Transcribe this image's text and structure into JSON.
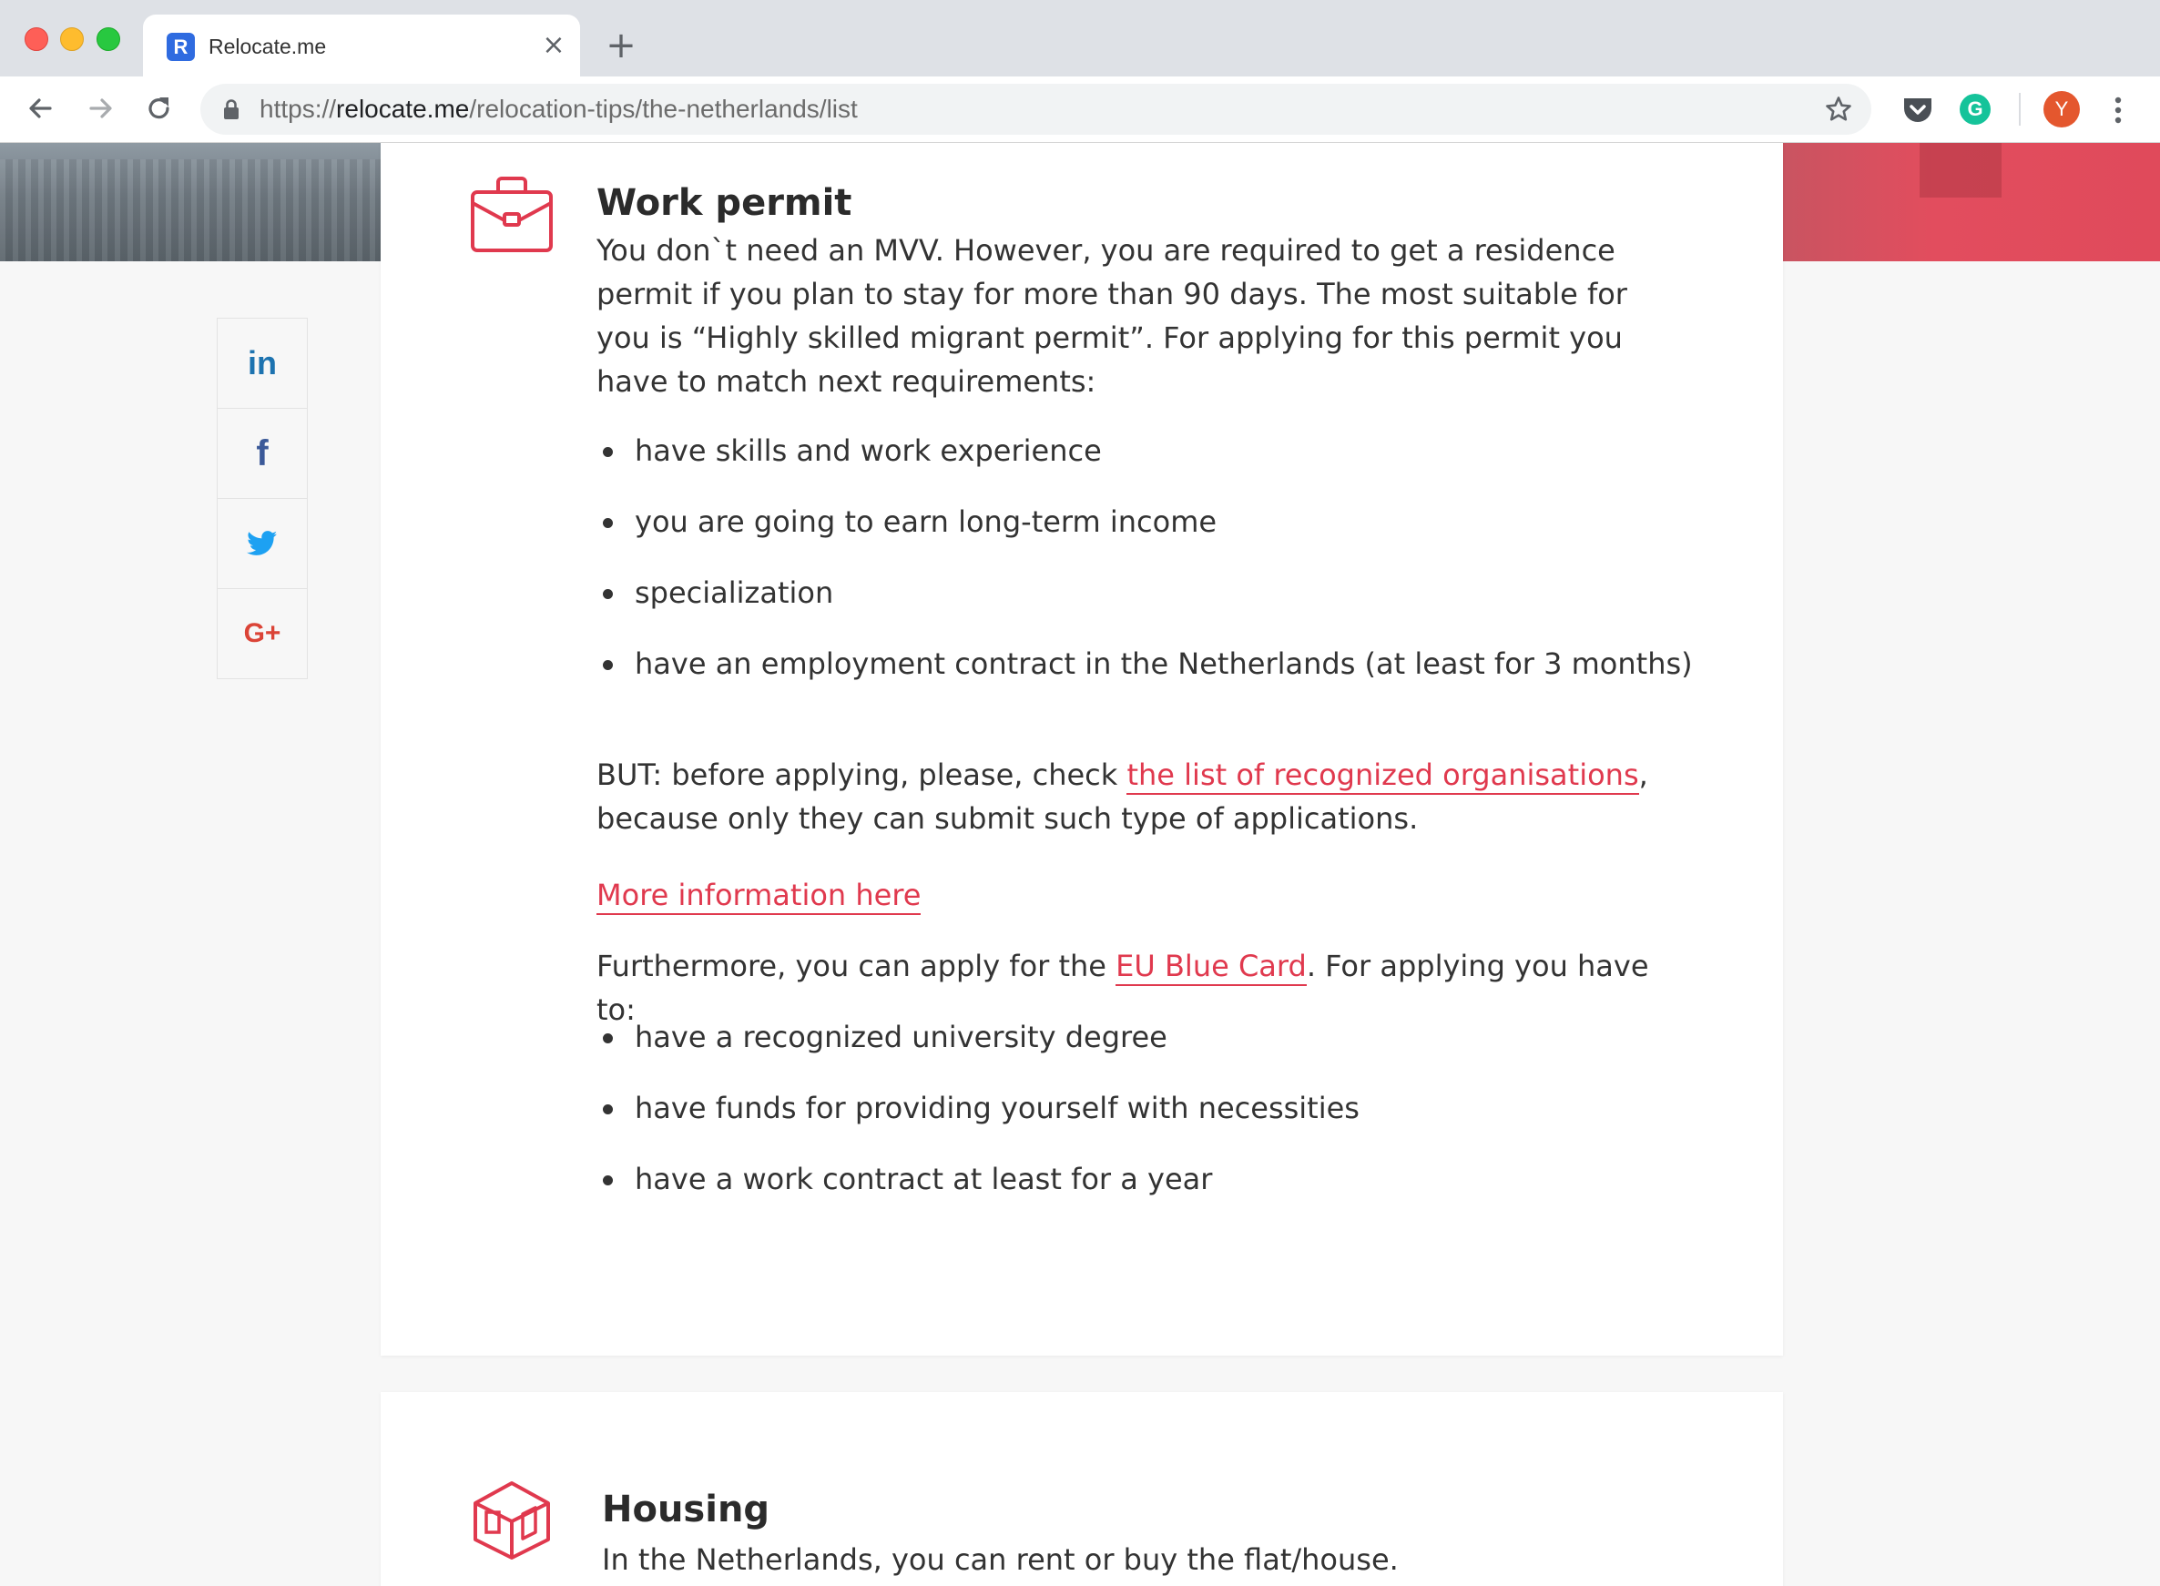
{
  "browser": {
    "tab_title": "Relocate.me",
    "tab_favicon_letter": "R",
    "url_scheme": "https://",
    "url_host": "relocate.me",
    "url_path": "/relocation-tips/the-netherlands/list",
    "avatar_letter": "Y",
    "grammarly_letter": "G",
    "tab_close_glyph": "×",
    "new_tab_glyph": "+"
  },
  "share": {
    "items": [
      {
        "network": "linkedin",
        "glyph": "in",
        "icon": "linkedin-icon"
      },
      {
        "network": "facebook",
        "glyph": "f",
        "icon": "facebook-icon"
      },
      {
        "network": "twitter",
        "glyph": "",
        "icon": "twitter-icon"
      },
      {
        "network": "google-plus",
        "glyph": "G+",
        "icon": "google-plus-icon"
      }
    ]
  },
  "work_permit": {
    "icon": "briefcase-icon",
    "title": "Work permit",
    "intro": "You don`t need an MVV. However, you are required to get a residence permit if you plan to stay for more than 90 days. The most suitable for you is “Highly skilled migrant permit”. For applying for this permit you have to match next requirements:",
    "requirements": [
      "have skills and work experience",
      "you are going to earn long-term income",
      "specialization",
      "have an employment contract in the Netherlands (at least for 3 months)"
    ],
    "but_prefix": "BUT: before applying, please, check ",
    "but_link": "the list of recognized organisations",
    "but_suffix": ", because only they can submit such type of applications.",
    "more_info_link": "More information here",
    "blue_card_prefix": "Furthermore, you can apply for the ",
    "blue_card_link": "EU Blue Card",
    "blue_card_suffix": ". For applying you have to:",
    "blue_card_requirements": [
      "have a recognized university degree",
      "have funds for providing yourself with necessities",
      "have a work contract at least for a year"
    ]
  },
  "housing": {
    "icon": "housing-icon",
    "title": "Housing",
    "intro": "In the Netherlands, you can rent or buy the flat/house."
  },
  "colors": {
    "accent": "#e0394e",
    "page_background": "#f7f7f7",
    "card_background": "#ffffff",
    "linkedin": "#1d73b0",
    "facebook": "#3b5998",
    "twitter": "#1da1f2",
    "google_plus": "#db4437"
  }
}
